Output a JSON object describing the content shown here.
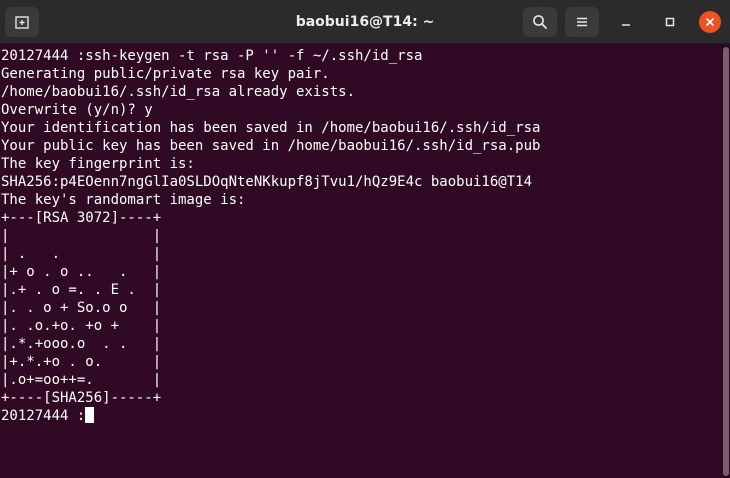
{
  "window": {
    "title": "baobui16@T14: ~",
    "icons": {
      "new_tab": "new-tab-icon",
      "search": "search-icon",
      "menu": "hamburger-menu-icon",
      "minimize": "minimize-icon",
      "maximize": "maximize-icon",
      "close": "close-icon"
    },
    "colors": {
      "titlebar": "#2b2b2b",
      "terminal_bg": "#300a24",
      "text": "#ffffff",
      "close_accent": "#e95420"
    }
  },
  "terminal": {
    "lines": [
      "20127444 :ssh-keygen -t rsa -P '' -f ~/.ssh/id_rsa",
      "Generating public/private rsa key pair.",
      "/home/baobui16/.ssh/id_rsa already exists.",
      "Overwrite (y/n)? y",
      "Your identification has been saved in /home/baobui16/.ssh/id_rsa",
      "Your public key has been saved in /home/baobui16/.ssh/id_rsa.pub",
      "The key fingerprint is:",
      "SHA256:p4EOenn7ngGlIa0SLDOqNteNKkupf8jTvu1/hQz9E4c baobui16@T14",
      "The key's randomart image is:",
      "+---[RSA 3072]----+",
      "|                 |",
      "| .   .           |",
      "|+ o . o ..   .   |",
      "|.+ . o =. . E .  |",
      "|. . o + So.o o   |",
      "|. .o.+o. +o +    |",
      "|.*.+ooo.o  . .   |",
      "|+.*.+o . o.      |",
      "|.o+=oo++=.       |",
      "+----[SHA256]-----+"
    ],
    "prompt": "20127444 :"
  }
}
